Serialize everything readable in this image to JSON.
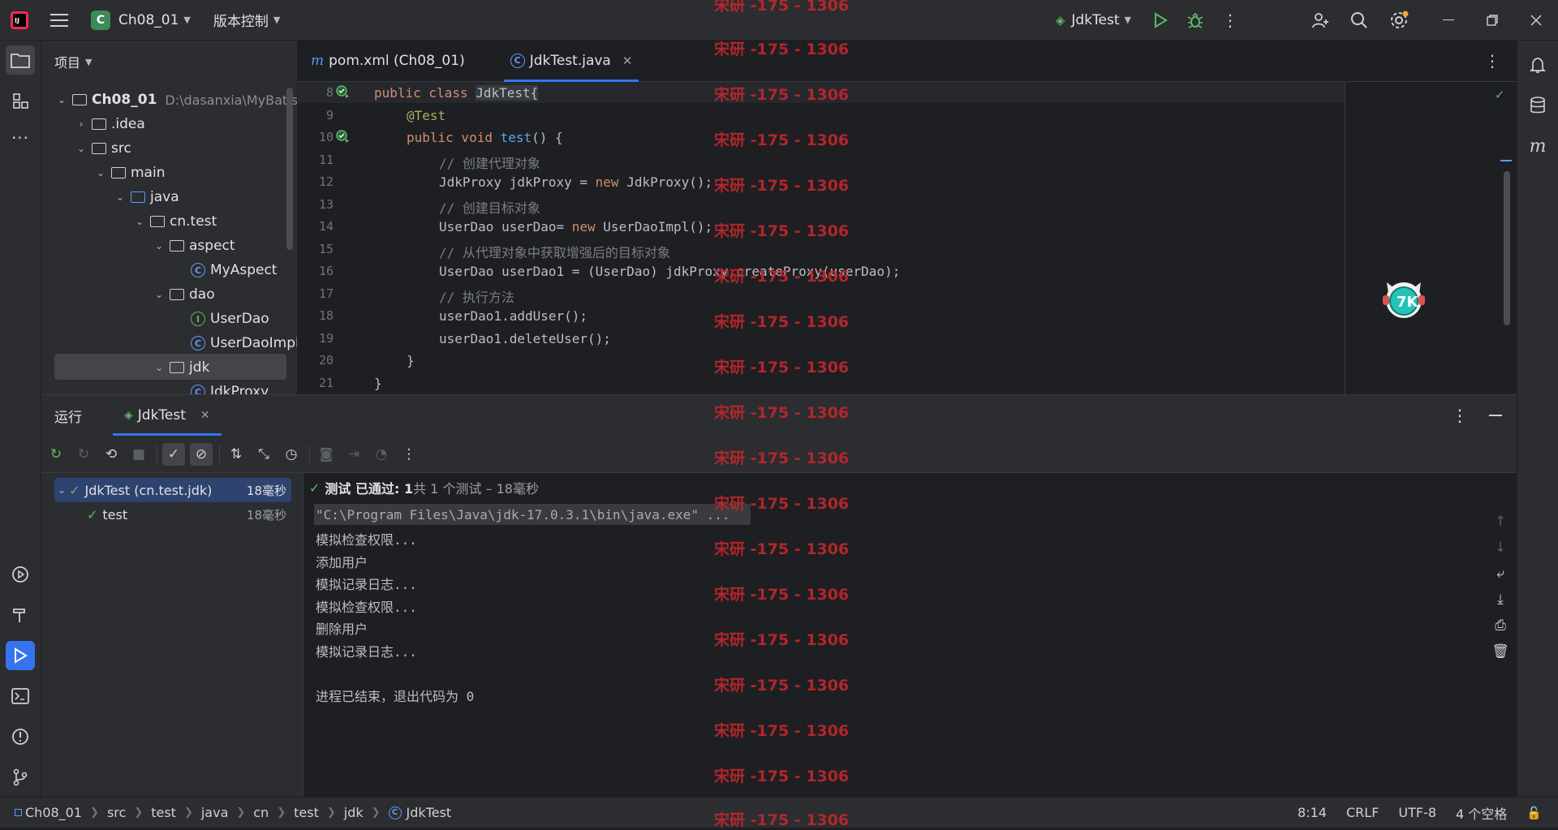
{
  "titlebar": {
    "project_badge": "C",
    "project_name": "Ch08_01",
    "vcs_label": "版本控制",
    "run_config": "JdkTest"
  },
  "project_panel": {
    "title": "项目",
    "root_name": "Ch08_01",
    "root_path": "D:\\dasanxia\\MyBatis\\",
    "items": [
      {
        "label": ".idea"
      },
      {
        "label": "src"
      },
      {
        "label": "main"
      },
      {
        "label": "java"
      },
      {
        "label": "cn.test"
      },
      {
        "label": "aspect"
      },
      {
        "label": "MyAspect"
      },
      {
        "label": "dao"
      },
      {
        "label": "UserDao"
      },
      {
        "label": "UserDaoImpl"
      },
      {
        "label": "jdk"
      },
      {
        "label": "JdkProxy"
      }
    ]
  },
  "editor": {
    "tabs": [
      {
        "label": "pom.xml (Ch08_01)",
        "icon": "maven-icon"
      },
      {
        "label": "JdkTest.java",
        "icon": "class-icon"
      }
    ],
    "lines": [
      {
        "no": "8"
      },
      {
        "no": "9"
      },
      {
        "no": "10"
      },
      {
        "no": "11"
      },
      {
        "no": "12"
      },
      {
        "no": "13"
      },
      {
        "no": "14"
      },
      {
        "no": "15"
      },
      {
        "no": "16"
      },
      {
        "no": "17"
      },
      {
        "no": "18"
      },
      {
        "no": "19"
      },
      {
        "no": "20"
      },
      {
        "no": "21"
      }
    ],
    "code": {
      "l8a": "public class ",
      "l8b": "JdkTest{",
      "l9": "@Test",
      "l10a": "public void ",
      "l10b": "test",
      "l10c": "() {",
      "l11": "// 创建代理对象",
      "l12a": "JdkProxy jdkProxy = ",
      "l12b": "new ",
      "l12c": "JdkProxy();",
      "l13": "// 创建目标对象",
      "l14a": "UserDao userDao= ",
      "l14b": "new ",
      "l14c": "UserDaoImpl();",
      "l15": "// 从代理对象中获取增强后的目标对象",
      "l16": "UserDao userDao1 = (UserDao) jdkProxy.createProxy(userDao);",
      "l17": "// 执行方法",
      "l18": "userDao1.addUser();",
      "l19": "userDao1.deleteUser();",
      "l20": "}",
      "l21": "}"
    }
  },
  "run_panel": {
    "title": "运行",
    "tab_label": "JdkTest",
    "tree": [
      {
        "label": "JdkTest (cn.test.jdk)",
        "time": "18毫秒"
      },
      {
        "label": "test",
        "time": "18毫秒"
      }
    ],
    "summary_passed": "测试 已通过: 1",
    "summary_rest": "共 1 个测试 – 18毫秒",
    "console": [
      "\"C:\\Program Files\\Java\\jdk-17.0.3.1\\bin\\java.exe\" ...",
      "模拟检查权限...",
      "添加用户",
      "模拟记录日志...",
      "模拟检查权限...",
      "删除用户",
      "模拟记录日志...",
      "",
      "进程已结束，退出代码为 0"
    ]
  },
  "statusbar": {
    "breadcrumbs": [
      "Ch08_01",
      "src",
      "test",
      "java",
      "cn",
      "test",
      "jdk",
      "JdkTest"
    ],
    "position": "8:14",
    "line_sep": "CRLF",
    "encoding": "UTF-8",
    "indent": "4 个空格"
  },
  "watermark": "宋研 -175 - 1306",
  "colors": {
    "accent": "#3574f0",
    "success": "#5fb865",
    "keyword": "#cf8e6d",
    "annotation": "#b3ae60",
    "watermark": "#c1272d"
  }
}
